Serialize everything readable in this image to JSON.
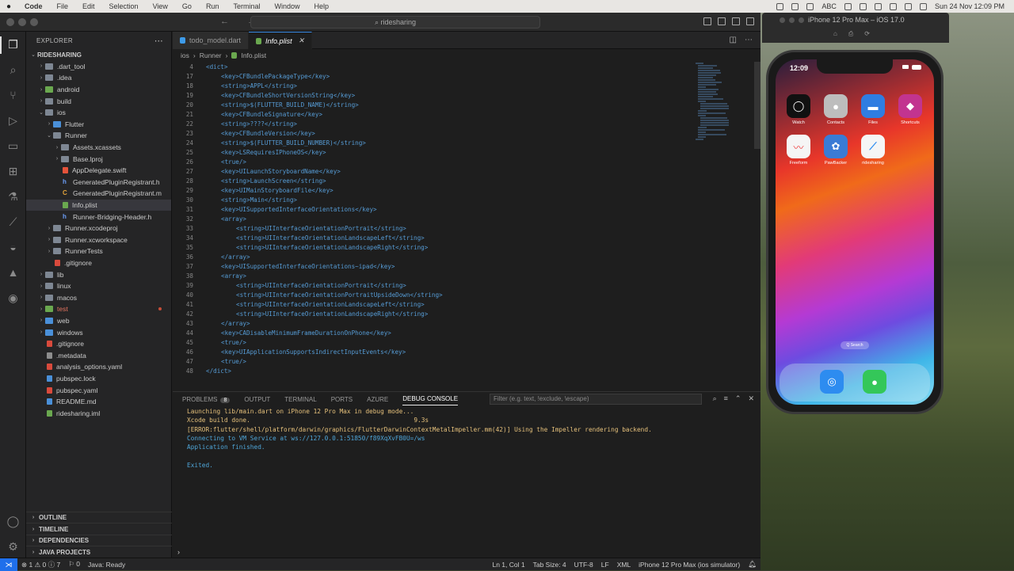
{
  "menubar": {
    "app_name": "Code",
    "items": [
      "File",
      "Edit",
      "Selection",
      "View",
      "Go",
      "Run",
      "Terminal",
      "Window",
      "Help"
    ],
    "input_indicator": "ABC",
    "datetime": "Sun 24 Nov  12:09 PM"
  },
  "titlebar": {
    "search": "ridesharing"
  },
  "sidebar": {
    "title": "EXPLORER",
    "root": "RIDESHARING",
    "tree": [
      {
        "label": ".dart_tool",
        "depth": 1,
        "type": "folder",
        "chev": "›"
      },
      {
        "label": ".idea",
        "depth": 1,
        "type": "folder",
        "chev": "›"
      },
      {
        "label": "android",
        "depth": 1,
        "type": "folder-green",
        "chev": "›"
      },
      {
        "label": "build",
        "depth": 1,
        "type": "folder",
        "chev": "›"
      },
      {
        "label": "ios",
        "depth": 1,
        "type": "folder",
        "chev": "⌄"
      },
      {
        "label": "Flutter",
        "depth": 2,
        "type": "folder-blue",
        "chev": "›"
      },
      {
        "label": "Runner",
        "depth": 2,
        "type": "folder",
        "chev": "⌄"
      },
      {
        "label": "Assets.xcassets",
        "depth": 3,
        "type": "folder",
        "chev": "›"
      },
      {
        "label": "Base.lproj",
        "depth": 3,
        "type": "folder",
        "chev": "›"
      },
      {
        "label": "AppDelegate.swift",
        "depth": 3,
        "type": "file-swift",
        "chev": ""
      },
      {
        "label": "GeneratedPluginRegistrant.h",
        "depth": 3,
        "type": "file-h",
        "chev": ""
      },
      {
        "label": "GeneratedPluginRegistrant.m",
        "depth": 3,
        "type": "file-c",
        "chev": ""
      },
      {
        "label": "Info.plist",
        "depth": 3,
        "type": "file-plist",
        "chev": "",
        "selected": true
      },
      {
        "label": "Runner-Bridging-Header.h",
        "depth": 3,
        "type": "file-h",
        "chev": ""
      },
      {
        "label": "Runner.xcodeproj",
        "depth": 2,
        "type": "folder",
        "chev": "›"
      },
      {
        "label": "Runner.xcworkspace",
        "depth": 2,
        "type": "folder",
        "chev": "›"
      },
      {
        "label": "RunnerTests",
        "depth": 2,
        "type": "folder",
        "chev": "›"
      },
      {
        "label": ".gitignore",
        "depth": 2,
        "type": "file-red",
        "chev": ""
      },
      {
        "label": "lib",
        "depth": 1,
        "type": "folder",
        "chev": "›"
      },
      {
        "label": "linux",
        "depth": 1,
        "type": "folder",
        "chev": "›"
      },
      {
        "label": "macos",
        "depth": 1,
        "type": "folder",
        "chev": "›"
      },
      {
        "label": "test",
        "depth": 1,
        "type": "folder-green",
        "chev": "›",
        "error": true
      },
      {
        "label": "web",
        "depth": 1,
        "type": "folder-blue",
        "chev": "›"
      },
      {
        "label": "windows",
        "depth": 1,
        "type": "folder-blue",
        "chev": "›"
      },
      {
        "label": ".gitignore",
        "depth": 1,
        "type": "file-red",
        "chev": ""
      },
      {
        "label": ".metadata",
        "depth": 1,
        "type": "file-gray",
        "chev": ""
      },
      {
        "label": "analysis_options.yaml",
        "depth": 1,
        "type": "file-red",
        "chev": ""
      },
      {
        "label": "pubspec.lock",
        "depth": 1,
        "type": "file-blue",
        "chev": ""
      },
      {
        "label": "pubspec.yaml",
        "depth": 1,
        "type": "file-red",
        "chev": ""
      },
      {
        "label": "README.md",
        "depth": 1,
        "type": "file-blue",
        "chev": ""
      },
      {
        "label": "ridesharing.iml",
        "depth": 1,
        "type": "file-green",
        "chev": ""
      }
    ],
    "sections": [
      "OUTLINE",
      "TIMELINE",
      "DEPENDENCIES",
      "JAVA PROJECTS"
    ]
  },
  "editor": {
    "tabs": [
      {
        "label": "todo_model.dart",
        "active": false
      },
      {
        "label": "Info.plist",
        "active": true
      }
    ],
    "breadcrumb": [
      "ios",
      "Runner",
      "Info.plist"
    ],
    "lines": [
      {
        "n": "4",
        "indent": 0,
        "code": "<dict>"
      },
      {
        "n": "17",
        "indent": 1,
        "code": "<key>CFBundlePackageType</key>"
      },
      {
        "n": "18",
        "indent": 1,
        "code": "<string>APPL</string>"
      },
      {
        "n": "19",
        "indent": 1,
        "code": "<key>CFBundleShortVersionString</key>"
      },
      {
        "n": "20",
        "indent": 1,
        "code": "<string>$(FLUTTER_BUILD_NAME)</string>"
      },
      {
        "n": "21",
        "indent": 1,
        "code": "<key>CFBundleSignature</key>"
      },
      {
        "n": "22",
        "indent": 1,
        "code": "<string>????</string>"
      },
      {
        "n": "23",
        "indent": 1,
        "code": "<key>CFBundleVersion</key>"
      },
      {
        "n": "24",
        "indent": 1,
        "code": "<string>$(FLUTTER_BUILD_NUMBER)</string>"
      },
      {
        "n": "25",
        "indent": 1,
        "code": "<key>LSRequiresIPhoneOS</key>"
      },
      {
        "n": "26",
        "indent": 1,
        "code": "<true/>"
      },
      {
        "n": "27",
        "indent": 1,
        "code": "<key>UILaunchStoryboardName</key>"
      },
      {
        "n": "28",
        "indent": 1,
        "code": "<string>LaunchScreen</string>"
      },
      {
        "n": "29",
        "indent": 1,
        "code": "<key>UIMainStoryboardFile</key>"
      },
      {
        "n": "30",
        "indent": 1,
        "code": "<string>Main</string>"
      },
      {
        "n": "31",
        "indent": 1,
        "code": "<key>UISupportedInterfaceOrientations</key>"
      },
      {
        "n": "32",
        "indent": 1,
        "code": "<array>"
      },
      {
        "n": "33",
        "indent": 2,
        "code": "<string>UIInterfaceOrientationPortrait</string>"
      },
      {
        "n": "34",
        "indent": 2,
        "code": "<string>UIInterfaceOrientationLandscapeLeft</string>"
      },
      {
        "n": "35",
        "indent": 2,
        "code": "<string>UIInterfaceOrientationLandscapeRight</string>"
      },
      {
        "n": "36",
        "indent": 1,
        "code": "</array>"
      },
      {
        "n": "37",
        "indent": 1,
        "code": "<key>UISupportedInterfaceOrientations~ipad</key>"
      },
      {
        "n": "38",
        "indent": 1,
        "code": "<array>"
      },
      {
        "n": "39",
        "indent": 2,
        "code": "<string>UIInterfaceOrientationPortrait</string>"
      },
      {
        "n": "40",
        "indent": 2,
        "code": "<string>UIInterfaceOrientationPortraitUpsideDown</string>"
      },
      {
        "n": "41",
        "indent": 2,
        "code": "<string>UIInterfaceOrientationLandscapeLeft</string>"
      },
      {
        "n": "42",
        "indent": 2,
        "code": "<string>UIInterfaceOrientationLandscapeRight</string>"
      },
      {
        "n": "43",
        "indent": 1,
        "code": "</array>"
      },
      {
        "n": "44",
        "indent": 1,
        "code": "<key>CADisableMinimumFrameDurationOnPhone</key>"
      },
      {
        "n": "45",
        "indent": 1,
        "code": "<true/>"
      },
      {
        "n": "46",
        "indent": 1,
        "code": "<key>UIApplicationSupportsIndirectInputEvents</key>"
      },
      {
        "n": "47",
        "indent": 1,
        "code": "<true/>"
      },
      {
        "n": "48",
        "indent": 0,
        "code": "</dict>"
      }
    ]
  },
  "panel": {
    "tabs": [
      "PROBLEMS",
      "OUTPUT",
      "TERMINAL",
      "PORTS",
      "AZURE",
      "DEBUG CONSOLE"
    ],
    "problems_count": "8",
    "active_tab": "DEBUG CONSOLE",
    "filter_placeholder": "Filter (e.g. text, !exclude, \\escape)",
    "console": [
      {
        "text": "Launching lib/main.dart on iPhone 12 Pro Max in debug mode...",
        "color": "yellow"
      },
      {
        "text": "Xcode build done.                                            9.3s",
        "color": "yellow"
      },
      {
        "text": "[ERROR:flutter/shell/platform/darwin/graphics/FlutterDarwinContextMetalImpeller.mm(42)] Using the Impeller rendering backend.",
        "color": "yellow"
      },
      {
        "text": "Connecting to VM Service at ws://127.0.0.1:51850/f89XqXvFB0U=/ws",
        "color": "blue"
      },
      {
        "text": "Application finished.",
        "color": "blue"
      },
      {
        "text": "",
        "color": "blue"
      },
      {
        "text": "Exited.",
        "color": "blue"
      }
    ]
  },
  "statusbar": {
    "left": [
      "⊗ 1 ⚠ 0 ⓘ 7",
      "⚐ 0",
      "Java: Ready"
    ],
    "right": [
      "Ln 1, Col 1",
      "Tab Size: 4",
      "UTF-8",
      "LF",
      "XML",
      "iPhone 12 Pro Max (ios simulator)"
    ]
  },
  "simulator": {
    "title": "iPhone 12 Pro Max – iOS 17.0",
    "time": "12:09",
    "apps_row1": [
      {
        "label": "Watch",
        "color": "#111111",
        "glyph": "◯"
      },
      {
        "label": "Contacts",
        "color": "#bdbdbd",
        "glyph": "●"
      },
      {
        "label": "Files",
        "color": "#2f7de1",
        "glyph": "▬"
      },
      {
        "label": "Shortcuts",
        "color": "#c2348f",
        "glyph": "◆"
      }
    ],
    "apps_row2": [
      {
        "label": "Freeform",
        "color": "#f5f5f5",
        "glyph": "〰"
      },
      {
        "label": "PawBacker",
        "color": "#3a7bd5",
        "glyph": "✿"
      },
      {
        "label": "ridesharing",
        "color": "#f5f5f5",
        "glyph": "⟋"
      }
    ],
    "search_label": "Q Search",
    "dock": [
      {
        "label": "Safari",
        "color": "#2d8cf0",
        "glyph": "◎"
      },
      {
        "label": "Messages",
        "color": "#34c759",
        "glyph": "●"
      }
    ]
  }
}
